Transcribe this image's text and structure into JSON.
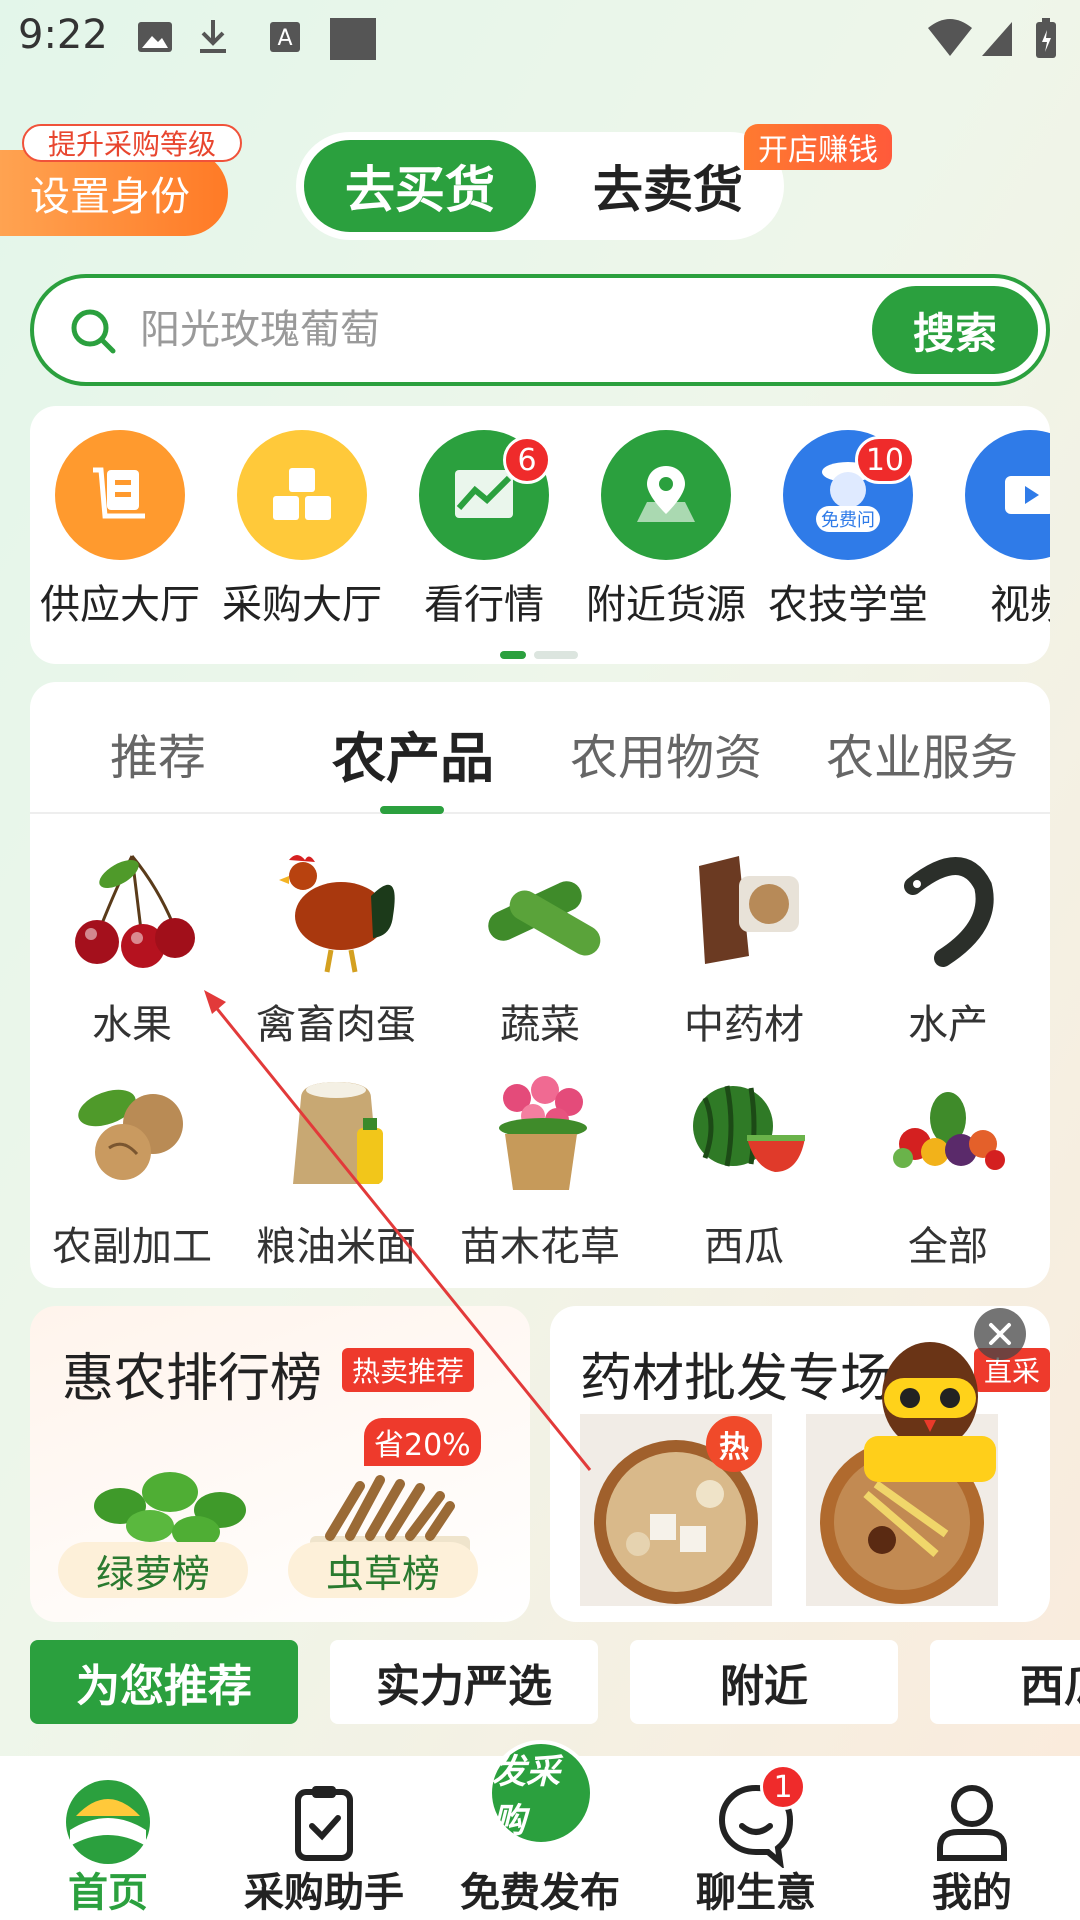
{
  "status_bar": {
    "time": "9:22"
  },
  "header": {
    "role_button": "设置身份",
    "role_tag": "提升采购等级",
    "mode_buy": "去买货",
    "mode_sell": "去卖货",
    "shop_tag": "开店赚钱"
  },
  "search": {
    "placeholder": "阳光玫瑰葡萄",
    "button": "搜索"
  },
  "quick_entries": [
    {
      "label": "供应大厅",
      "icon": "cart-icon",
      "color": "#ff9a2e"
    },
    {
      "label": "采购大厅",
      "icon": "boxes-icon",
      "color": "#ffc93a"
    },
    {
      "label": "看行情",
      "icon": "trend-icon",
      "color": "#2ba03e",
      "badge": "6"
    },
    {
      "label": "附近货源",
      "icon": "location-icon",
      "color": "#2ba03e"
    },
    {
      "label": "农技学堂",
      "icon": "teacher-icon",
      "color": "#2f7be8",
      "badge": "10",
      "icon_text": "免费问"
    },
    {
      "label": "视频",
      "icon": "video-icon",
      "color": "#2f7be8"
    }
  ],
  "category_tabs": [
    "推荐",
    "农产品",
    "农用物资",
    "农业服务"
  ],
  "categories": [
    {
      "label": "水果",
      "icon": "cherry-icon"
    },
    {
      "label": "禽畜肉蛋",
      "icon": "rooster-icon"
    },
    {
      "label": "蔬菜",
      "icon": "cucumber-icon"
    },
    {
      "label": "中药材",
      "icon": "herb-icon"
    },
    {
      "label": "水产",
      "icon": "fish-icon"
    },
    {
      "label": "农副加工",
      "icon": "walnut-icon"
    },
    {
      "label": "粮油米面",
      "icon": "rice-oil-icon"
    },
    {
      "label": "苗木花草",
      "icon": "flower-pot-icon"
    },
    {
      "label": "西瓜",
      "icon": "watermelon-icon"
    },
    {
      "label": "全部",
      "icon": "vegetables-icon"
    }
  ],
  "promo_left": {
    "title": "惠农排行榜",
    "tag": "热卖推荐",
    "discount": "省20%",
    "items": [
      "绿萝榜",
      "虫草榜"
    ]
  },
  "promo_right": {
    "title": "药材批发专场",
    "tag": "直采",
    "hot": "热"
  },
  "filter_chips": [
    "为您推荐",
    "实力严选",
    "附近",
    "西瓜"
  ],
  "bottom_nav": {
    "items": [
      "首页",
      "采购助手",
      "免费发布",
      "聊生意",
      "我的"
    ],
    "publish_label": "发采购",
    "chat_badge": "1"
  },
  "colors": {
    "brand_green": "#2ba03e",
    "orange": "#ff7a26",
    "red": "#ee3a2c"
  }
}
